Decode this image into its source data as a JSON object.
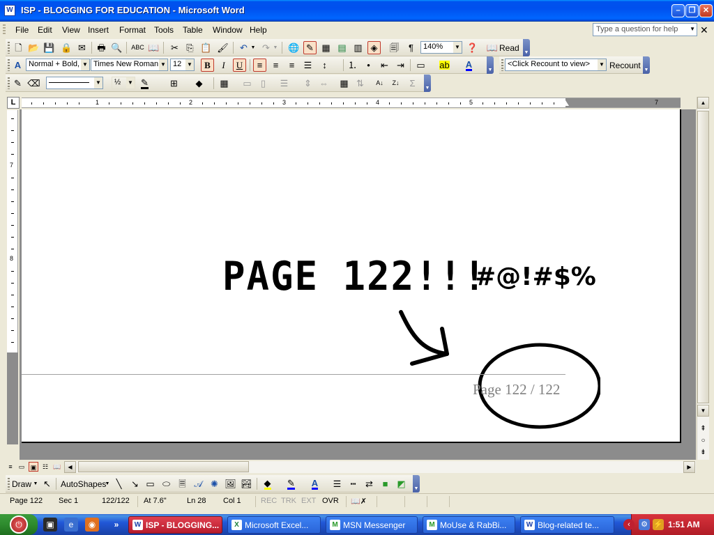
{
  "window": {
    "title": "ISP - BLOGGING FOR EDUCATION - Microsoft Word",
    "app_icon": "W",
    "controls": {
      "minimize": "–",
      "restore": "❐",
      "close": "✕"
    }
  },
  "menu": {
    "items": [
      "File",
      "Edit",
      "View",
      "Insert",
      "Format",
      "Tools",
      "Table",
      "Window",
      "Help"
    ],
    "ask_placeholder": "Type a question for help",
    "close_doc": "✕"
  },
  "toolbar_standard": {
    "zoom": "140%",
    "read_label": "Read"
  },
  "toolbar_formatting": {
    "style": "Normal + Bold,",
    "font": "Times New Roman",
    "size": "12",
    "bold": "B",
    "italic": "I",
    "underline": "U",
    "recount_select": "<Click Recount to view>",
    "recount_label": "Recount"
  },
  "toolbar_tables": {
    "line_weight": "½"
  },
  "ruler": {
    "corner": "L",
    "h_numbers": [
      "1",
      "2",
      "3",
      "4",
      "5",
      "7"
    ],
    "v_numbers": [
      "7",
      "8"
    ]
  },
  "document": {
    "scrawl_text": "PAGE 122!!!",
    "scrawl_symbols": "#@!#$%",
    "footer_text": "Page 122 / 122"
  },
  "drawing_toolbar": {
    "draw_label": "Draw",
    "autoshapes_label": "AutoShapes"
  },
  "status": {
    "page": "Page 122",
    "sec": "Sec 1",
    "page_of": "122/122",
    "at": "At 7.6\"",
    "ln": "Ln 28",
    "col": "Col 1",
    "rec": "REC",
    "trk": "TRK",
    "ext": "EXT",
    "ovr": "OVR"
  },
  "taskbar": {
    "tasks": [
      {
        "label": "ISP - BLOGGING...",
        "icon": "W",
        "active": true
      },
      {
        "label": "Microsoft Excel...",
        "icon": "X",
        "active": false
      },
      {
        "label": "MSN Messenger",
        "icon": "M",
        "active": false
      },
      {
        "label": "MoUse & RabBi...",
        "icon": "M",
        "active": false
      },
      {
        "label": "Blog-related te...",
        "icon": "W",
        "active": false
      }
    ],
    "clock": "1:51 AM",
    "more": "»"
  },
  "colors": {
    "titlebar": "#0050ee",
    "active_task": "#e04050",
    "pressed_button_border": "#c0392b"
  }
}
